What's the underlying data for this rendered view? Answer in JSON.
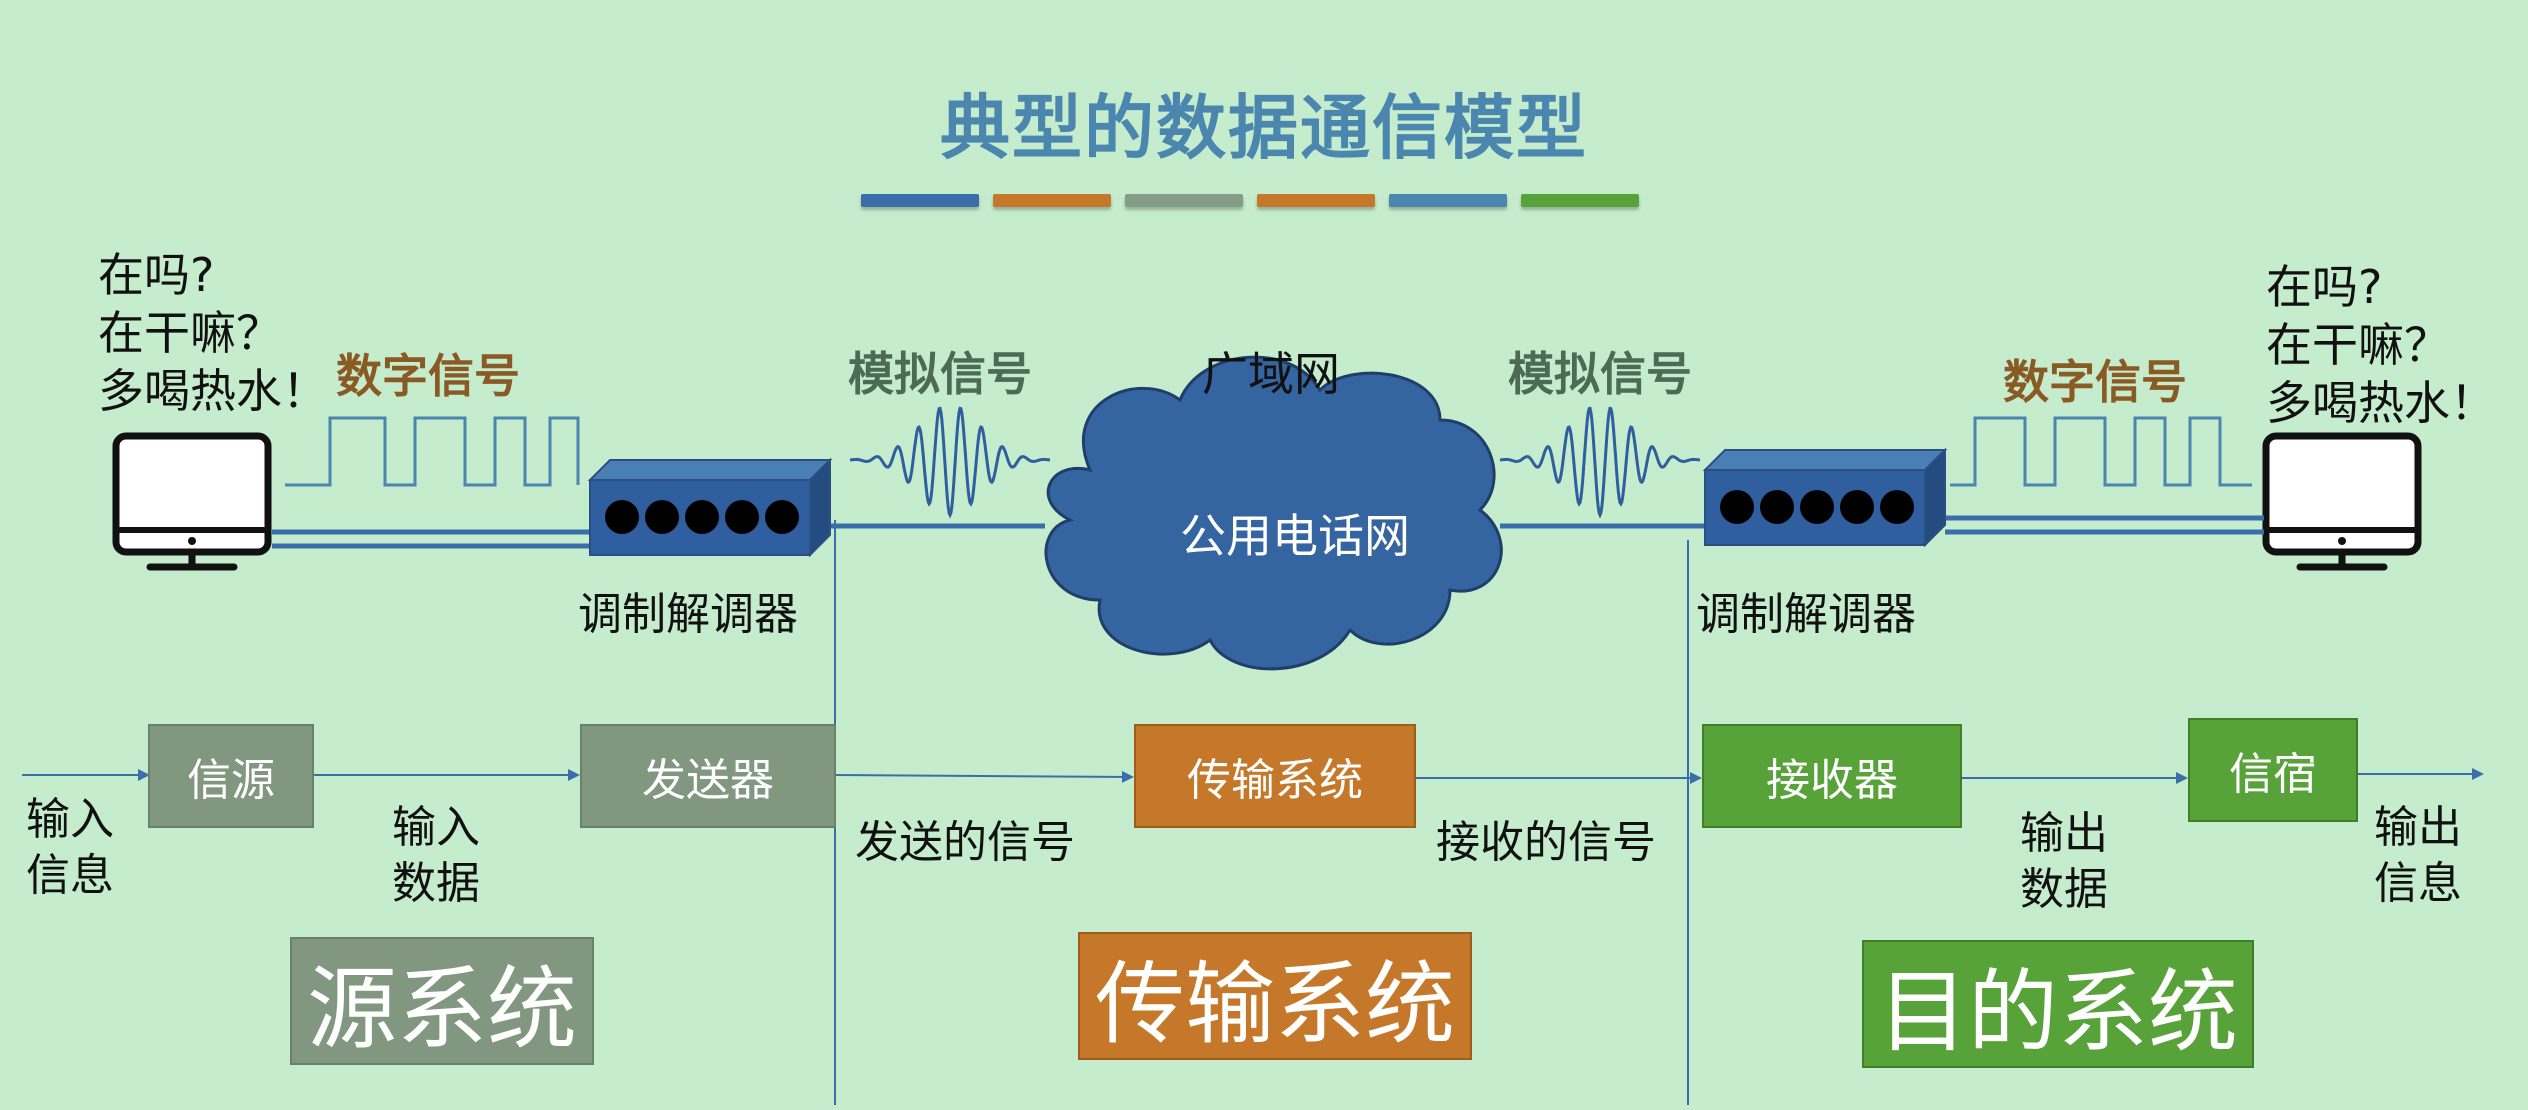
{
  "title": "典型的数据通信模型",
  "title_bar_colors": [
    "#3a6ea8",
    "#c6782a",
    "#859c86",
    "#c6782a",
    "#4a86ad",
    "#58a23a"
  ],
  "left_chat": [
    "在吗?",
    "在干嘛？",
    "多喝热水！"
  ],
  "right_chat": [
    "在吗?",
    "在干嘛？",
    "多喝热水！"
  ],
  "signals": {
    "digital_left": "数字信号",
    "analog_left": "模拟信号",
    "wan": "广域网",
    "analog_right": "模拟信号",
    "digital_right": "数字信号"
  },
  "cloud_label": "公用电话网",
  "modem_left_label": "调制解调器",
  "modem_right_label": "调制解调器",
  "flow": {
    "input_info": [
      "输入",
      "信息"
    ],
    "source": "信源",
    "input_data": [
      "输入",
      "数据"
    ],
    "transmitter": "发送器",
    "sent_signal": "发送的信号",
    "transmission_system": "传输系统",
    "received_signal": "接收的信号",
    "receiver": "接收器",
    "output_data": [
      "输出",
      "数据"
    ],
    "destination": "信宿",
    "output_info": [
      "输出",
      "信息"
    ]
  },
  "sections": {
    "source_system": "源系统",
    "transmission_system": "传输系统",
    "destination_system": "目的系统"
  },
  "colors": {
    "background": "#c6ecce",
    "title": "#4a86ad",
    "digital_signal": "#8a5a24",
    "analog_signal": "#4d6a55",
    "grey_box": "#819780",
    "orange_box": "#c6782a",
    "green_box": "#58a23a",
    "modem": "#2f5f9e",
    "cloud": "#3565a0",
    "line": "#3a6ea8"
  },
  "icons": [
    "monitor-icon",
    "modem-icon",
    "cloud-icon",
    "arrow-icon"
  ]
}
